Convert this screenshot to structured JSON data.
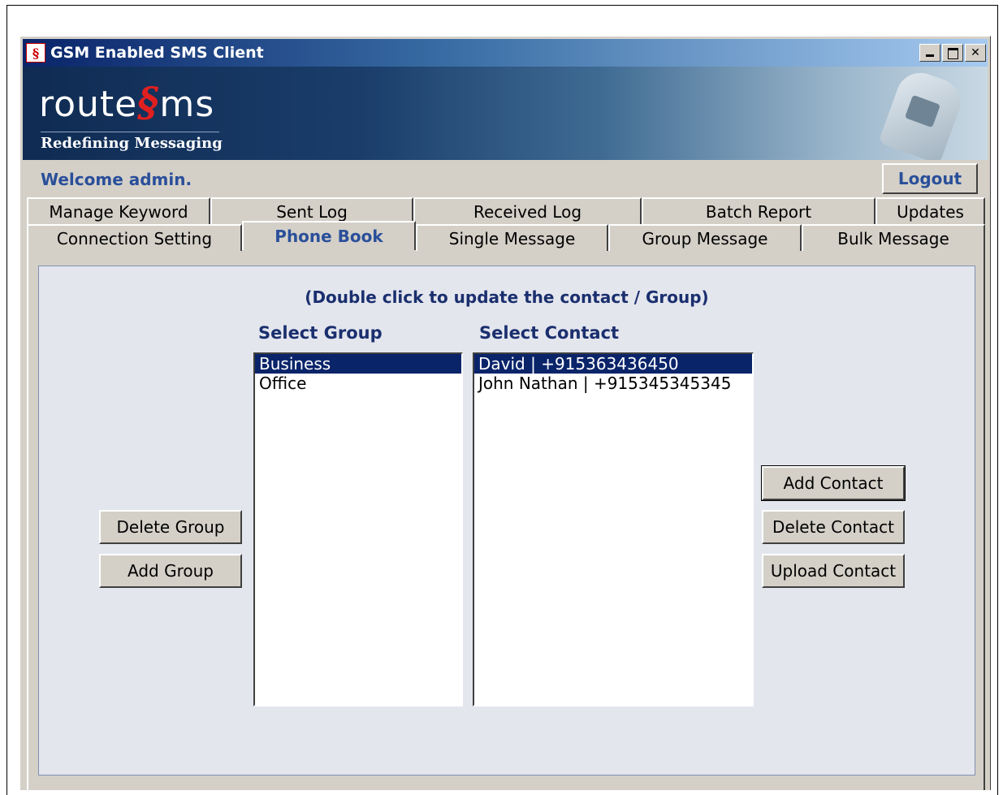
{
  "window": {
    "title": "GSM Enabled SMS Client",
    "icon": "sms-app-icon",
    "controls": [
      "minimize",
      "maximize",
      "close"
    ]
  },
  "banner": {
    "logo_left": "route",
    "logo_right": "ms",
    "tagline": "Redefining Messaging"
  },
  "header": {
    "welcome": "Welcome admin.",
    "logout_label": "Logout"
  },
  "tabs_back": [
    {
      "label": "Manage Keyword"
    },
    {
      "label": "Sent Log"
    },
    {
      "label": "Received Log"
    },
    {
      "label": "Batch Report"
    },
    {
      "label": "Updates"
    }
  ],
  "tabs_front": [
    {
      "label": "Connection Setting",
      "active": false
    },
    {
      "label": "Phone Book",
      "active": true
    },
    {
      "label": "Single Message",
      "active": false
    },
    {
      "label": "Group Message",
      "active": false
    },
    {
      "label": "Bulk Message",
      "active": false
    }
  ],
  "phonebook": {
    "hint": "(Double click to update the contact / Group)",
    "group_label": "Select Group",
    "contact_label": "Select Contact",
    "groups": [
      "Business",
      "Office"
    ],
    "selected_group": "Business",
    "contacts": [
      "David | +915363436450",
      "John Nathan | +915345345345"
    ],
    "selected_contact": "David | +915363436450",
    "buttons": {
      "delete_group": "Delete Group",
      "add_group": "Add Group",
      "add_contact": "Add Contact",
      "delete_contact": "Delete Contact",
      "upload_contact": "Upload Contact"
    }
  },
  "colors": {
    "title_gradient_start": "#0a246a",
    "accent_text": "#2a4f9a",
    "selection": "#0a246a",
    "panel_bg": "#e4e6ee"
  }
}
